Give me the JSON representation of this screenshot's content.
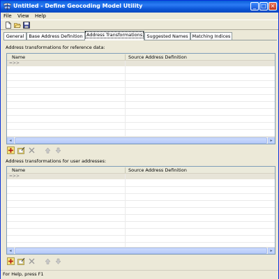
{
  "window": {
    "title": "Untitled - Define Geocoding Model Utility"
  },
  "menu": {
    "file": "File",
    "view": "View",
    "help": "Help"
  },
  "toolbar": {
    "icons": [
      "new-file-icon",
      "open-folder-icon",
      "save-icon"
    ]
  },
  "tabs": [
    {
      "label": "General",
      "active": false
    },
    {
      "label": "Base Address Definition",
      "active": false
    },
    {
      "label": "Address Transformations",
      "active": true
    },
    {
      "label": "Suggested Names",
      "active": false
    },
    {
      "label": "Matching Indices",
      "active": false
    }
  ],
  "reference": {
    "label": "Address transformations for reference data:",
    "columns": [
      "Name",
      "Source Address Definition"
    ],
    "new_row_marker": "=>>"
  },
  "user": {
    "label": "Address transformations for user addresses:",
    "columns": [
      "Name",
      "Source Address Definition"
    ],
    "new_row_marker": "=>>"
  },
  "row_tools": [
    "add-row-icon",
    "edit-row-icon",
    "delete-row-icon",
    "move-up-icon",
    "move-down-icon"
  ],
  "statusbar": {
    "text": "For Help, press F1"
  },
  "colors": {
    "titlebar": "#0a5fd8",
    "face": "#ece9d8",
    "grid_border": "#7f9db9"
  }
}
